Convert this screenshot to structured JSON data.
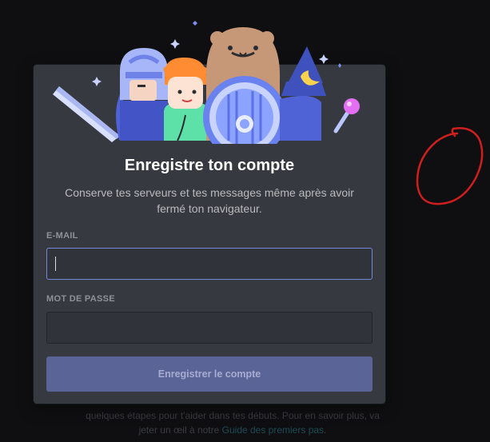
{
  "background": {
    "line1": "quelques étapes pour t'aider dans tes débuts. Pour en savoir plus, va",
    "line2_prefix": "jeter un œil à notre ",
    "line2_link": "Guide des premiers pas",
    "line2_suffix": "."
  },
  "modal": {
    "title": "Enregistre ton compte",
    "subtitle": "Conserve tes serveurs et tes messages même après avoir fermé ton navigateur.",
    "email_label": "E-MAIL",
    "email_value": "",
    "password_label": "MOT DE PASSE",
    "password_value": "",
    "submit_label": "Enregistrer le compte"
  },
  "colors": {
    "accent": "#7289da",
    "modal_bg": "#36393f",
    "annotation": "#d01f1f"
  },
  "icons": {
    "illustration": "discord-characters-illustration",
    "annotation": "hand-drawn-red-circle"
  }
}
